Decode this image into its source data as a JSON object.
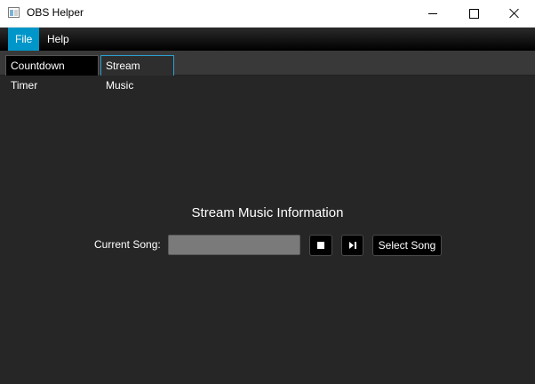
{
  "window": {
    "title": "OBS Helper"
  },
  "menu": {
    "file": "File",
    "help": "Help"
  },
  "tabs": [
    {
      "label": "Countdown Timer",
      "active": false
    },
    {
      "label": "Stream Music",
      "active": true
    }
  ],
  "stream_music": {
    "heading": "Stream Music Information",
    "current_song_label": "Current Song:",
    "current_song_value": "",
    "select_song_label": "Select Song"
  },
  "icons": [
    "app-icon",
    "minimize-icon",
    "maximize-icon",
    "close-icon",
    "stop-icon",
    "skip-next-icon"
  ],
  "colors": {
    "accent": "#0096c9",
    "active_tab_border": "#2aa1d3",
    "background": "#262626"
  }
}
